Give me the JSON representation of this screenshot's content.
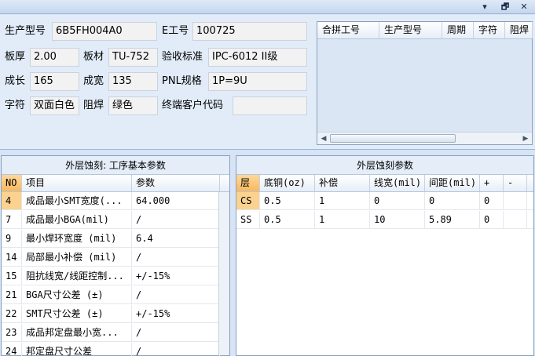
{
  "window": {
    "minimize": "▾",
    "restore": "🗗",
    "close": "✕"
  },
  "form": {
    "model_label": "生产型号",
    "model_value": "6B5FH004A0",
    "e_label": "E工号",
    "e_value": "100725",
    "thick_label": "板厚",
    "thick_value": "2.00",
    "board_label": "板材",
    "board_value": "TU-752",
    "std_label": "验收标准",
    "std_value": "IPC-6012 II级",
    "len_label": "成长",
    "len_value": "165",
    "width_label": "成宽",
    "width_value": "135",
    "pnl_label": "PNL规格",
    "pnl_value": "1P=9U",
    "char_label": "字符",
    "char_value": "双面白色",
    "mask_label": "阻焊",
    "mask_value": "绿色",
    "cust_label": "终端客户代码",
    "cust_value": ""
  },
  "merge_grid": {
    "headers": [
      "合拼工号",
      "生产型号",
      "周期",
      "字符",
      "阻焊"
    ]
  },
  "left_panel": {
    "title": "外层蚀刻: 工序基本参数",
    "headers": [
      "NO",
      "项目",
      "参数"
    ],
    "rows": [
      {
        "no": "4",
        "item": "成品最小SMT宽度(...",
        "param": "64.000"
      },
      {
        "no": "7",
        "item": "成品最小BGA(mil)",
        "param": "/"
      },
      {
        "no": "9",
        "item": "最小焊环宽度 (mil)",
        "param": "6.4"
      },
      {
        "no": "14",
        "item": "局部最小补偿 (mil)",
        "param": "/"
      },
      {
        "no": "15",
        "item": "阻抗线宽/线距控制...",
        "param": "+/-15%"
      },
      {
        "no": "21",
        "item": "BGA尺寸公差 (±)",
        "param": "/"
      },
      {
        "no": "22",
        "item": "SMT尺寸公差 (±)",
        "param": "+/-15%"
      },
      {
        "no": "23",
        "item": "成品邦定盘最小宽...",
        "param": "/"
      },
      {
        "no": "24",
        "item": "邦定盘尺寸公差",
        "param": "/"
      }
    ]
  },
  "right_panel": {
    "title": "外层蚀刻参数",
    "headers": [
      "层",
      "底铜(oz)",
      "补偿",
      "线宽(mil)",
      "间距(mil)",
      "+",
      "-"
    ],
    "rows": [
      {
        "layer": "CS",
        "base": "0.5",
        "comp": "1",
        "width": "0",
        "space": "0",
        "plus": "0",
        "minus": ""
      },
      {
        "layer": "SS",
        "base": "0.5",
        "comp": "1",
        "width": "10",
        "space": "5.89",
        "plus": "0",
        "minus": ""
      }
    ]
  }
}
